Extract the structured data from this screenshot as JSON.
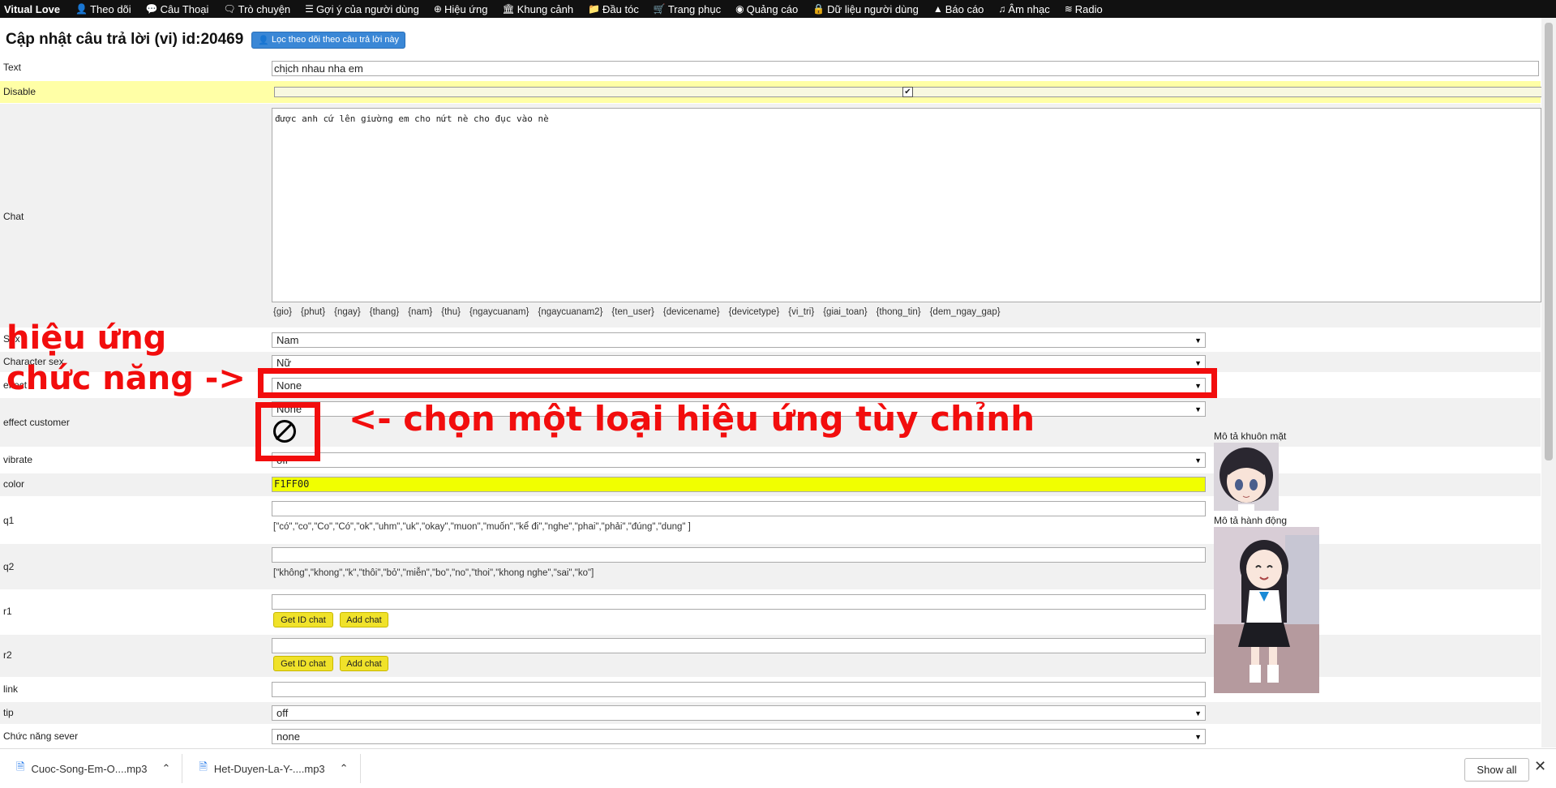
{
  "nav": {
    "brand": "Vitual Love",
    "items": [
      {
        "label": "Theo dõi",
        "icon": "user-icon",
        "glyph": "👤"
      },
      {
        "label": "Câu Thoại",
        "icon": "comment-icon",
        "glyph": "💬"
      },
      {
        "label": "Trò chuyện",
        "icon": "chat-icon",
        "glyph": "🗨"
      },
      {
        "label": "Gợi ý của người dùng",
        "icon": "list-icon",
        "glyph": "☰"
      },
      {
        "label": "Hiệu ứng",
        "icon": "circle-icon",
        "glyph": "⊕"
      },
      {
        "label": "Khung cảnh",
        "icon": "bank-icon",
        "glyph": "🏛"
      },
      {
        "label": "Đầu tóc",
        "icon": "folder-icon",
        "glyph": "📁"
      },
      {
        "label": "Trang phục",
        "icon": "cart-icon",
        "glyph": "🛒"
      },
      {
        "label": "Quảng cáo",
        "icon": "compass-icon",
        "glyph": "◉"
      },
      {
        "label": "Dữ liệu người dùng",
        "icon": "lock-icon",
        "glyph": "🔒"
      },
      {
        "label": "Báo cáo",
        "icon": "warning-icon",
        "glyph": "▲"
      },
      {
        "label": "Âm nhạc",
        "icon": "music-icon",
        "glyph": "♫"
      },
      {
        "label": "Radio",
        "icon": "wifi-icon",
        "glyph": "≋"
      }
    ]
  },
  "header": {
    "title": "Cập nhật câu trả lời (vi) id:20469",
    "filter_button": "Lọc theo dõi theo câu trả lời này"
  },
  "form": {
    "text_label": "Text",
    "text_value": "chịch nhau nha em",
    "disable_label": "Disable",
    "disable_checked": true,
    "chat_label": "Chat",
    "chat_value": "được anh cứ lên giường em cho nứt nè cho đục vào nè",
    "tags": [
      "{gio}",
      "{phut}",
      "{ngay}",
      "{thang}",
      "{nam}",
      "{thu}",
      "{ngaycuanam}",
      "{ngaycuanam2}",
      "{ten_user}",
      "{devicename}",
      "{devicetype}",
      "{vi_tri}",
      "{giai_toan}",
      "{thong_tin}",
      "{dem_ngay_gap}"
    ],
    "sex_label": "Sex",
    "sex_value": "Nam",
    "character_sex_label": "Character sex",
    "character_sex_value": "Nữ",
    "effect_label": "effect",
    "effect_value": "None",
    "effect_customer_label": "effect customer",
    "effect_customer_value": "None",
    "vibrate_label": "vibrate",
    "vibrate_value": "off",
    "color_label": "color",
    "color_value": "F1FF00",
    "q1_label": "q1",
    "q1_hint": "[\"có\",\"co\",\"Co\",\"Có\",\"ok\",\"uhm\",\"uk\",\"okay\",\"muon\",\"muốn\",\"kể đi\",\"nghe\",\"phai\",\"phải\",\"đúng\",\"dung\" ]",
    "q2_label": "q2",
    "q2_hint": "[\"không\",\"khong\",\"k\",\"thôi\",\"bỏ\",\"miễn\",\"bo\",\"no\",\"thoi\",\"khong nghe\",\"sai\",\"ko\"]",
    "r1_label": "r1",
    "r2_label": "r2",
    "get_id_label": "Get ID chat",
    "add_chat_label": "Add chat",
    "link_label": "link",
    "tip_label": "tip",
    "tip_value": "off",
    "server_function_label": "Chức năng sever",
    "server_function_value": "none"
  },
  "side": {
    "face_label": "Mô tả khuôn mặt",
    "action_label": "Mô tả hành động"
  },
  "annotations": {
    "left_line1": "hiệu ứng",
    "left_line2": "chức năng ->",
    "right_text": "<- chọn một loại hiệu ứng tùy chỉnh",
    "color": "#f20d0d"
  },
  "downloads": {
    "items": [
      "Cuoc-Song-Em-O....mp3",
      "Het-Duyen-La-Y-....mp3"
    ],
    "show_all": "Show all"
  }
}
